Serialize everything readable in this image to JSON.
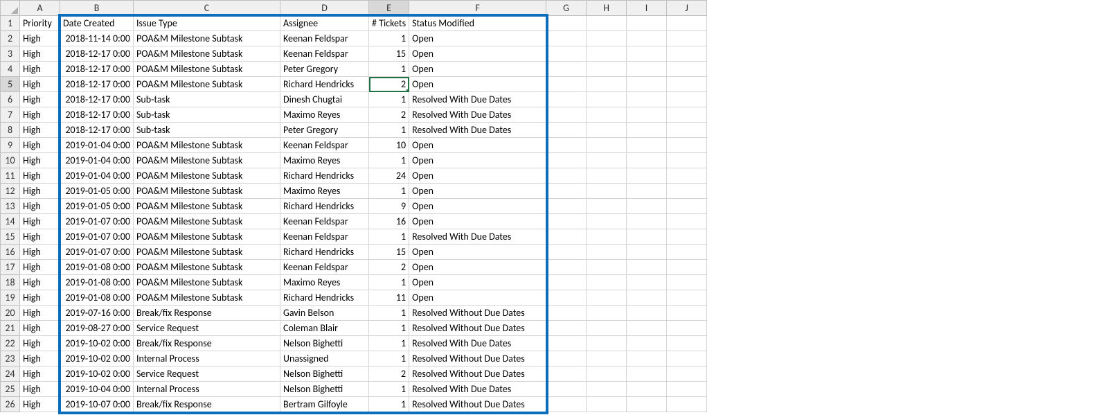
{
  "columns": [
    "A",
    "B",
    "C",
    "D",
    "E",
    "F",
    "G",
    "H",
    "I",
    "J"
  ],
  "headers": {
    "A": "Priority",
    "B": "Date Created",
    "C": "Issue Type",
    "D": "Assignee",
    "E": "# Tickets",
    "F": "Status Modified"
  },
  "rows": [
    {
      "n": 2,
      "A": "High",
      "B": "2018-11-14 0:00",
      "C": "POA&M Milestone Subtask",
      "D": "Keenan Feldspar",
      "E": 1,
      "F": "Open"
    },
    {
      "n": 3,
      "A": "High",
      "B": "2018-12-17 0:00",
      "C": "POA&M Milestone Subtask",
      "D": "Keenan Feldspar",
      "E": 15,
      "F": "Open"
    },
    {
      "n": 4,
      "A": "High",
      "B": "2018-12-17 0:00",
      "C": "POA&M Milestone Subtask",
      "D": "Peter Gregory",
      "E": 1,
      "F": "Open"
    },
    {
      "n": 5,
      "A": "High",
      "B": "2018-12-17 0:00",
      "C": "POA&M Milestone Subtask",
      "D": "Richard Hendricks",
      "E": 2,
      "F": "Open"
    },
    {
      "n": 6,
      "A": "High",
      "B": "2018-12-17 0:00",
      "C": "Sub-task",
      "D": "Dinesh Chugtai",
      "E": 1,
      "F": "Resolved With Due Dates"
    },
    {
      "n": 7,
      "A": "High",
      "B": "2018-12-17 0:00",
      "C": "Sub-task",
      "D": "Maximo Reyes",
      "E": 2,
      "F": "Resolved With Due Dates"
    },
    {
      "n": 8,
      "A": "High",
      "B": "2018-12-17 0:00",
      "C": "Sub-task",
      "D": "Peter Gregory",
      "E": 1,
      "F": "Resolved With Due Dates"
    },
    {
      "n": 9,
      "A": "High",
      "B": "2019-01-04 0:00",
      "C": "POA&M Milestone Subtask",
      "D": "Keenan Feldspar",
      "E": 10,
      "F": "Open"
    },
    {
      "n": 10,
      "A": "High",
      "B": "2019-01-04 0:00",
      "C": "POA&M Milestone Subtask",
      "D": "Maximo Reyes",
      "E": 1,
      "F": "Open"
    },
    {
      "n": 11,
      "A": "High",
      "B": "2019-01-04 0:00",
      "C": "POA&M Milestone Subtask",
      "D": "Richard Hendricks",
      "E": 24,
      "F": "Open"
    },
    {
      "n": 12,
      "A": "High",
      "B": "2019-01-05 0:00",
      "C": "POA&M Milestone Subtask",
      "D": "Maximo Reyes",
      "E": 1,
      "F": "Open"
    },
    {
      "n": 13,
      "A": "High",
      "B": "2019-01-05 0:00",
      "C": "POA&M Milestone Subtask",
      "D": "Richard Hendricks",
      "E": 9,
      "F": "Open"
    },
    {
      "n": 14,
      "A": "High",
      "B": "2019-01-07 0:00",
      "C": "POA&M Milestone Subtask",
      "D": "Keenan Feldspar",
      "E": 16,
      "F": "Open"
    },
    {
      "n": 15,
      "A": "High",
      "B": "2019-01-07 0:00",
      "C": "POA&M Milestone Subtask",
      "D": "Keenan Feldspar",
      "E": 1,
      "F": "Resolved With Due Dates"
    },
    {
      "n": 16,
      "A": "High",
      "B": "2019-01-07 0:00",
      "C": "POA&M Milestone Subtask",
      "D": "Richard Hendricks",
      "E": 15,
      "F": "Open"
    },
    {
      "n": 17,
      "A": "High",
      "B": "2019-01-08 0:00",
      "C": "POA&M Milestone Subtask",
      "D": "Keenan Feldspar",
      "E": 2,
      "F": "Open"
    },
    {
      "n": 18,
      "A": "High",
      "B": "2019-01-08 0:00",
      "C": "POA&M Milestone Subtask",
      "D": "Maximo Reyes",
      "E": 1,
      "F": "Open"
    },
    {
      "n": 19,
      "A": "High",
      "B": "2019-01-08 0:00",
      "C": "POA&M Milestone Subtask",
      "D": "Richard Hendricks",
      "E": 11,
      "F": "Open"
    },
    {
      "n": 20,
      "A": "High",
      "B": "2019-07-16 0:00",
      "C": "Break/fix Response",
      "D": "Gavin Belson",
      "E": 1,
      "F": "Resolved Without Due Dates"
    },
    {
      "n": 21,
      "A": "High",
      "B": "2019-08-27 0:00",
      "C": "Service Request",
      "D": "Coleman Blair",
      "E": 1,
      "F": "Resolved Without Due Dates"
    },
    {
      "n": 22,
      "A": "High",
      "B": "2019-10-02 0:00",
      "C": "Break/fix Response",
      "D": "Nelson Bighetti",
      "E": 1,
      "F": "Resolved With Due Dates"
    },
    {
      "n": 23,
      "A": "High",
      "B": "2019-10-02 0:00",
      "C": "Internal Process",
      "D": "Unassigned",
      "E": 1,
      "F": "Resolved Without Due Dates"
    },
    {
      "n": 24,
      "A": "High",
      "B": "2019-10-02 0:00",
      "C": "Service Request",
      "D": "Nelson Bighetti",
      "E": 2,
      "F": "Resolved Without Due Dates"
    },
    {
      "n": 25,
      "A": "High",
      "B": "2019-10-04 0:00",
      "C": "Internal Process",
      "D": "Nelson Bighetti",
      "E": 1,
      "F": "Resolved With Due Dates"
    },
    {
      "n": 26,
      "A": "High",
      "B": "2019-10-07 0:00",
      "C": "Break/fix Response",
      "D": "Bertram Gilfoyle",
      "E": 1,
      "F": "Resolved Without Due Dates"
    }
  ],
  "active_cell": "E5",
  "selected_row_header": 5,
  "selected_col_header": "E",
  "highlight": {
    "from_col": "B",
    "to_col": "F",
    "from_row": 1,
    "to_row": 26
  }
}
